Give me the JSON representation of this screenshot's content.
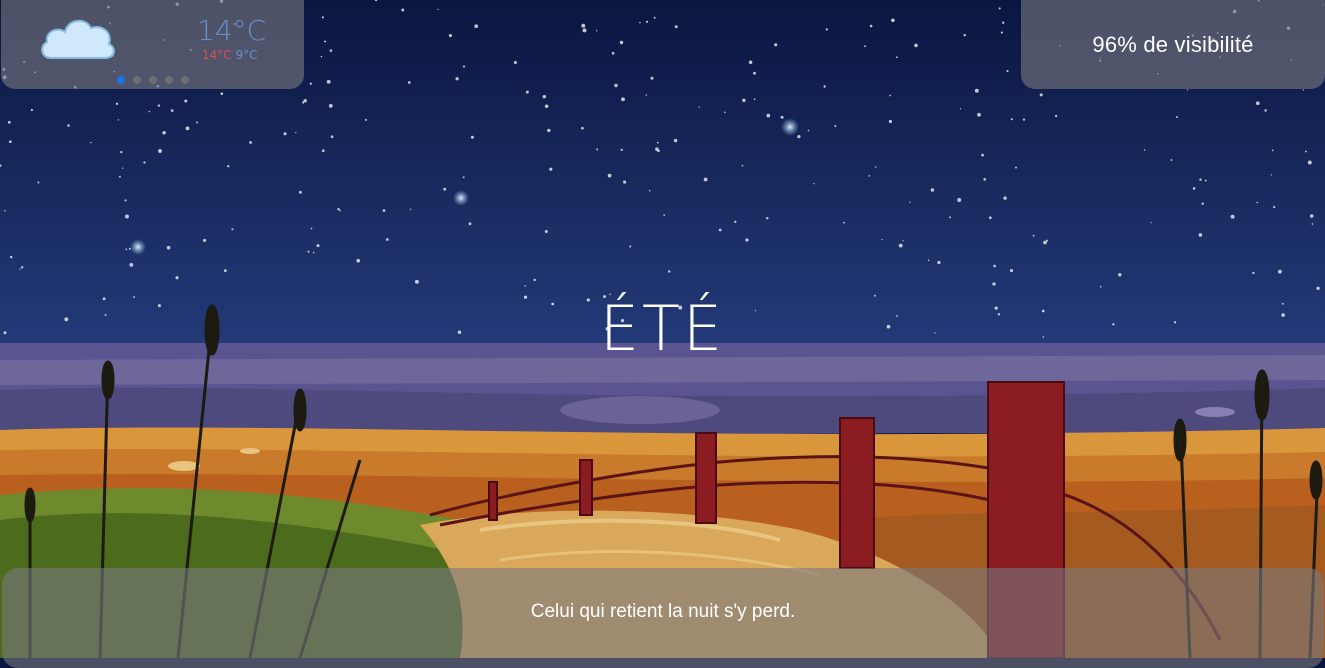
{
  "weather": {
    "icon": "cloud-icon",
    "temperature": "14°C",
    "temp_max": "14°C",
    "temp_min": "9°C",
    "pagination": {
      "count": 5,
      "active_index": 0
    }
  },
  "visibility": {
    "label": "96% de visibilité"
  },
  "season": {
    "title": "ÉTÉ"
  },
  "quote": {
    "text": "Celui qui retient la nuit s'y perd."
  },
  "colors": {
    "panel_bg": "#78787f",
    "temp_blue": "#6b8ed0",
    "temp_red": "#e05050",
    "dot_active": "#1b74e8",
    "sky_top": "#0b1640",
    "sky_bottom": "#1f3570"
  }
}
